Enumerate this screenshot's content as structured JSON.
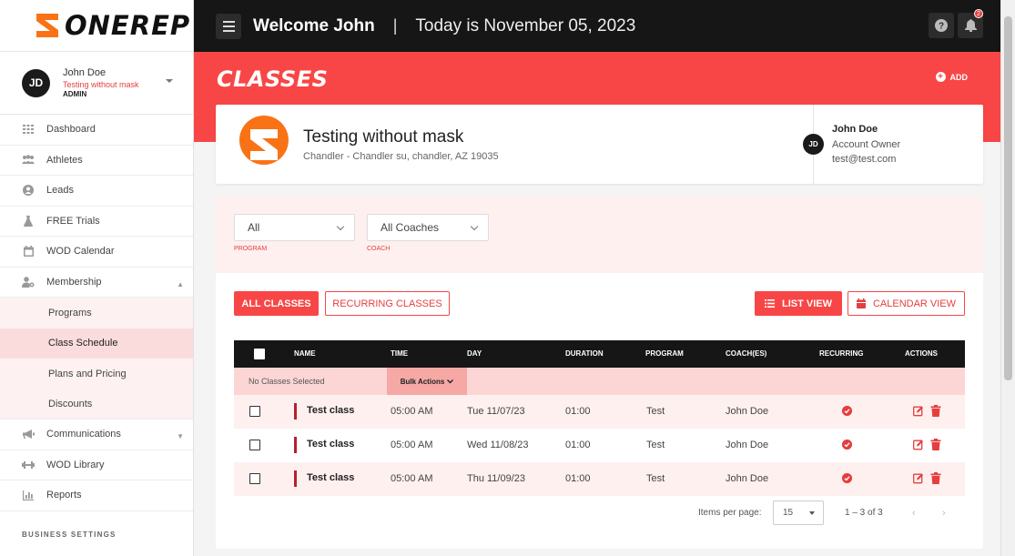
{
  "brand": {
    "name": "ONEREP",
    "accent": "#f84646"
  },
  "user": {
    "initials": "JD",
    "name": "John Doe",
    "gym": "Testing without mask",
    "role": "ADMIN"
  },
  "sidebar": {
    "items": [
      {
        "label": "Dashboard",
        "icon": "grid-icon"
      },
      {
        "label": "Athletes",
        "icon": "people-icon"
      },
      {
        "label": "Leads",
        "icon": "user-circle-icon"
      },
      {
        "label": "FREE Trials",
        "icon": "flask-icon"
      },
      {
        "label": "WOD Calendar",
        "icon": "calendar-icon"
      },
      {
        "label": "Membership",
        "icon": "user-gear-icon"
      }
    ],
    "membership_sub": [
      {
        "label": "Programs"
      },
      {
        "label": "Class Schedule"
      },
      {
        "label": "Plans and Pricing"
      },
      {
        "label": "Discounts"
      }
    ],
    "items_after": [
      {
        "label": "Communications",
        "icon": "megaphone-icon"
      },
      {
        "label": "WOD Library",
        "icon": "dumbbell-icon"
      },
      {
        "label": "Reports",
        "icon": "chart-icon"
      }
    ],
    "settings_label": "BUSINESS SETTINGS"
  },
  "topbar": {
    "welcome": "Welcome John",
    "separator": "|",
    "today": "Today is November 05, 2023",
    "notification_count": "2"
  },
  "header": {
    "title": "CLASSES",
    "add_label": "ADD"
  },
  "gym": {
    "name": "Testing without mask",
    "address": "Chandler - Chandler su, chandler, AZ 19035",
    "owner_initials": "JD",
    "owner_name": "John Doe",
    "owner_role": "Account Owner",
    "owner_email": "test@test.com"
  },
  "filters": {
    "program": {
      "value": "All",
      "label": "PROGRAM"
    },
    "coach": {
      "value": "All Coaches",
      "label": "COACH"
    }
  },
  "buttons": {
    "all_classes": "ALL CLASSES",
    "recurring_classes": "RECURRING CLASSES",
    "list_view": "LIST VIEW",
    "calendar_view": "CALENDAR VIEW"
  },
  "table": {
    "columns": [
      "NAME",
      "TIME",
      "DAY",
      "DURATION",
      "PROGRAM",
      "COACH(ES)",
      "RECURRING",
      "ACTIONS"
    ],
    "selection_text": "No Classes Selected",
    "bulk_actions": "Bulk Actions",
    "rows": [
      {
        "name": "Test class",
        "time": "05:00 AM",
        "day": "Tue 11/07/23",
        "duration": "01:00",
        "program": "Test",
        "coach": "John Doe",
        "recurring": true
      },
      {
        "name": "Test class",
        "time": "05:00 AM",
        "day": "Wed 11/08/23",
        "duration": "01:00",
        "program": "Test",
        "coach": "John Doe",
        "recurring": true
      },
      {
        "name": "Test class",
        "time": "05:00 AM",
        "day": "Thu 11/09/23",
        "duration": "01:00",
        "program": "Test",
        "coach": "John Doe",
        "recurring": true
      }
    ]
  },
  "pagination": {
    "items_per_page_label": "Items per page:",
    "items_per_page": "15",
    "range": "1 – 3 of 3"
  }
}
